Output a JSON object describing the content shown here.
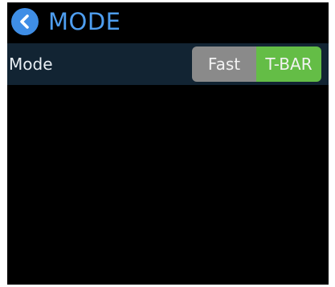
{
  "header": {
    "title": "MODE",
    "back_icon": "chevron-left-icon"
  },
  "mode_row": {
    "label": "Mode",
    "options": [
      "Fast",
      "T-BAR"
    ],
    "selected": "T-BAR"
  },
  "colors": {
    "accent": "#4e9ef0",
    "back_button": "#3f8ee6",
    "row_background": "#122433",
    "unselected_segment": "#8a8a8a",
    "selected_segment": "#64bd46",
    "screen_background": "#000000"
  }
}
